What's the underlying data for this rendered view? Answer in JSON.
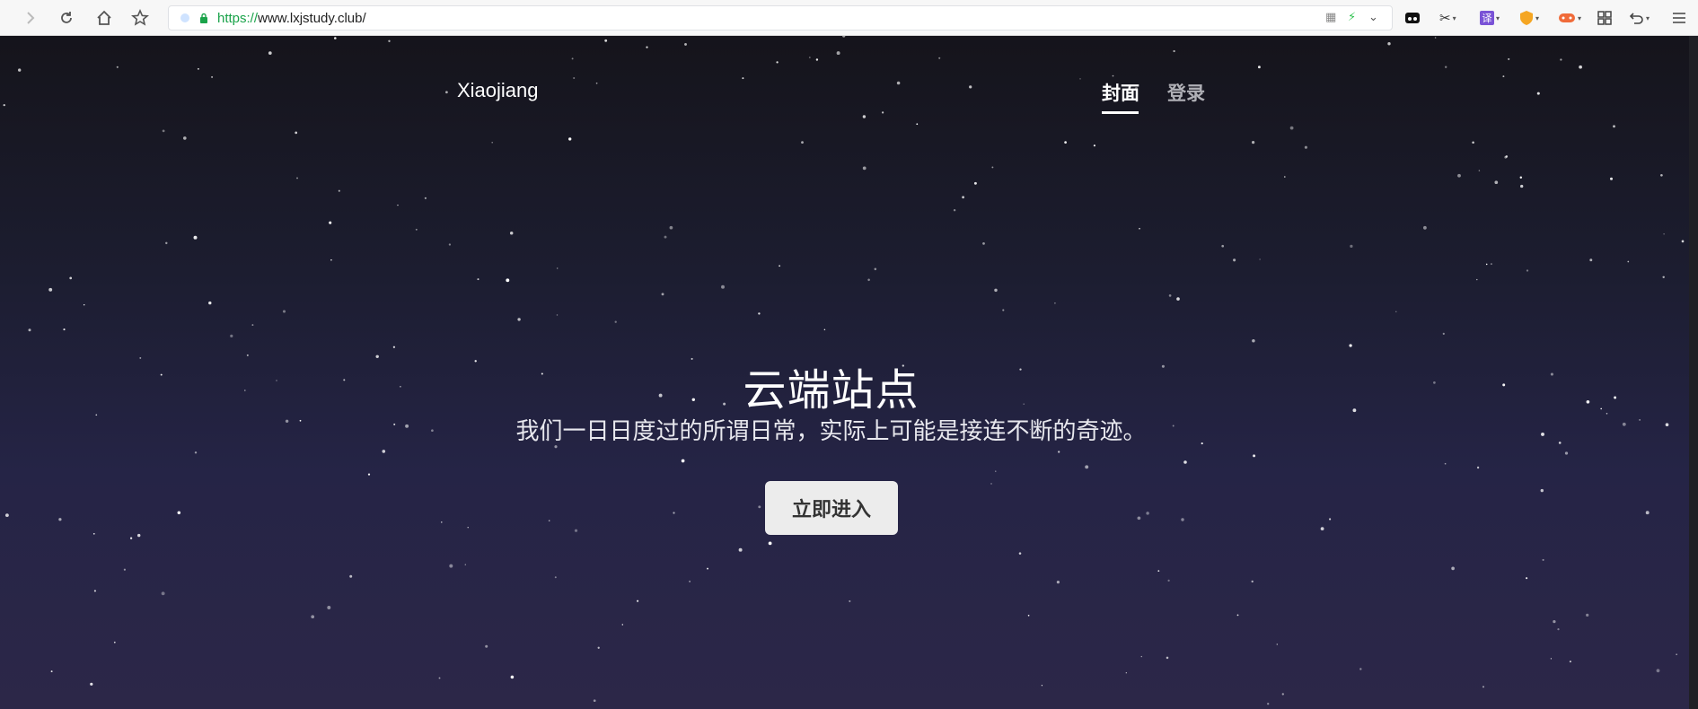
{
  "browser": {
    "url_scheme": "https://",
    "url_rest": "www.lxjstudy.club/",
    "icons": [
      "forward-icon",
      "reload-icon",
      "home-icon",
      "bookmark-star-icon",
      "lock-icon",
      "qr-icon",
      "lightning-icon",
      "chevron-down-icon",
      "incognito-icon",
      "scissors-icon",
      "translate-icon",
      "shield-icon",
      "game-icon",
      "grid-icon",
      "undo-icon",
      "menu-icon"
    ],
    "translate_glyph": "译"
  },
  "site": {
    "brand": "Xiaojiang",
    "nav": [
      {
        "label": "封面",
        "active": true
      },
      {
        "label": "登录",
        "active": false
      }
    ]
  },
  "hero": {
    "title": "云端站点",
    "subtitle": "我们一日日度过的所谓日常，实际上可能是接连不断的奇迹。",
    "button_label": "立即进入"
  },
  "colors": {
    "page_top": "#15141b",
    "page_bottom": "#2c2748",
    "accent_url": "#1aa34a"
  }
}
